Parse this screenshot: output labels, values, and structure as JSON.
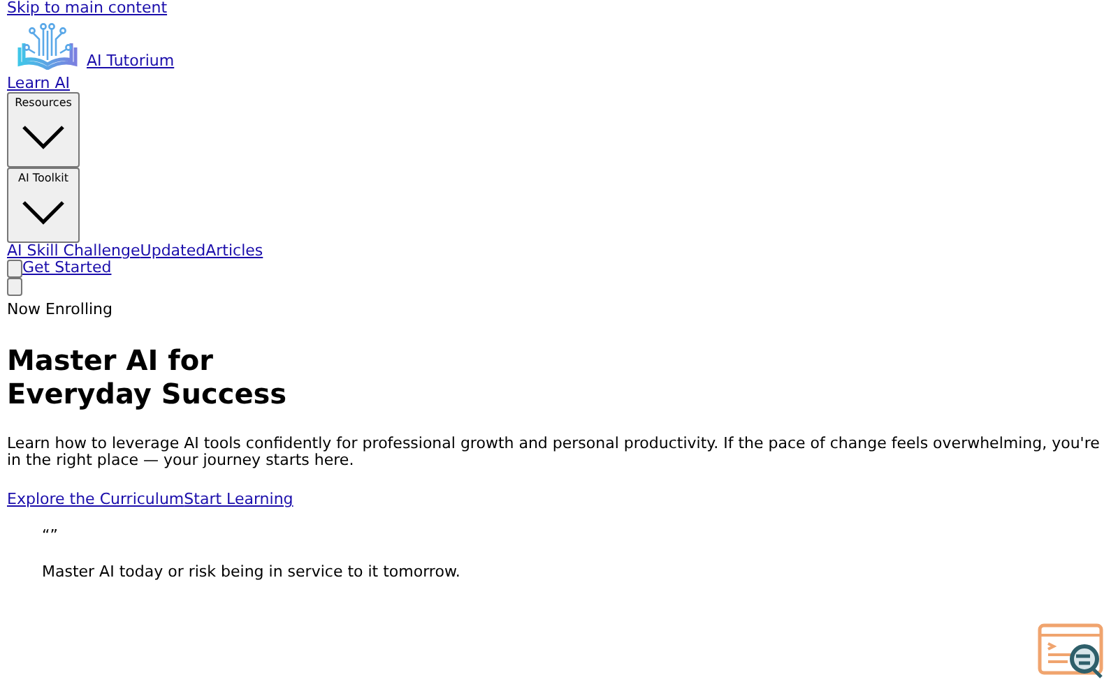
{
  "skip_link": "Skip to main content",
  "logo": {
    "text": "AI Tutorium"
  },
  "nav": [
    {
      "kind": "link",
      "label": "Learn AI"
    },
    {
      "kind": "dropdown",
      "label": "Resources"
    },
    {
      "kind": "dropdown",
      "label": "AI Toolkit"
    }
  ],
  "inline_links": [
    "AI Skill Challenge",
    "Updated",
    "Articles"
  ],
  "get_started": "Get Started",
  "hero": {
    "badge": "Now Enrolling",
    "title_lines": [
      "Master AI for",
      "Everyday Success"
    ],
    "description": "Learn how to leverage AI tools confidently for professional growth and personal productivity. If the pace of change feels overwhelming, you're in the right place — your journey starts here.",
    "ctas": [
      "Explore the Curriculum",
      "Start Learning"
    ],
    "quote_marks": "“”",
    "quote": "Master AI today or risk being in service to it tomorrow."
  }
}
